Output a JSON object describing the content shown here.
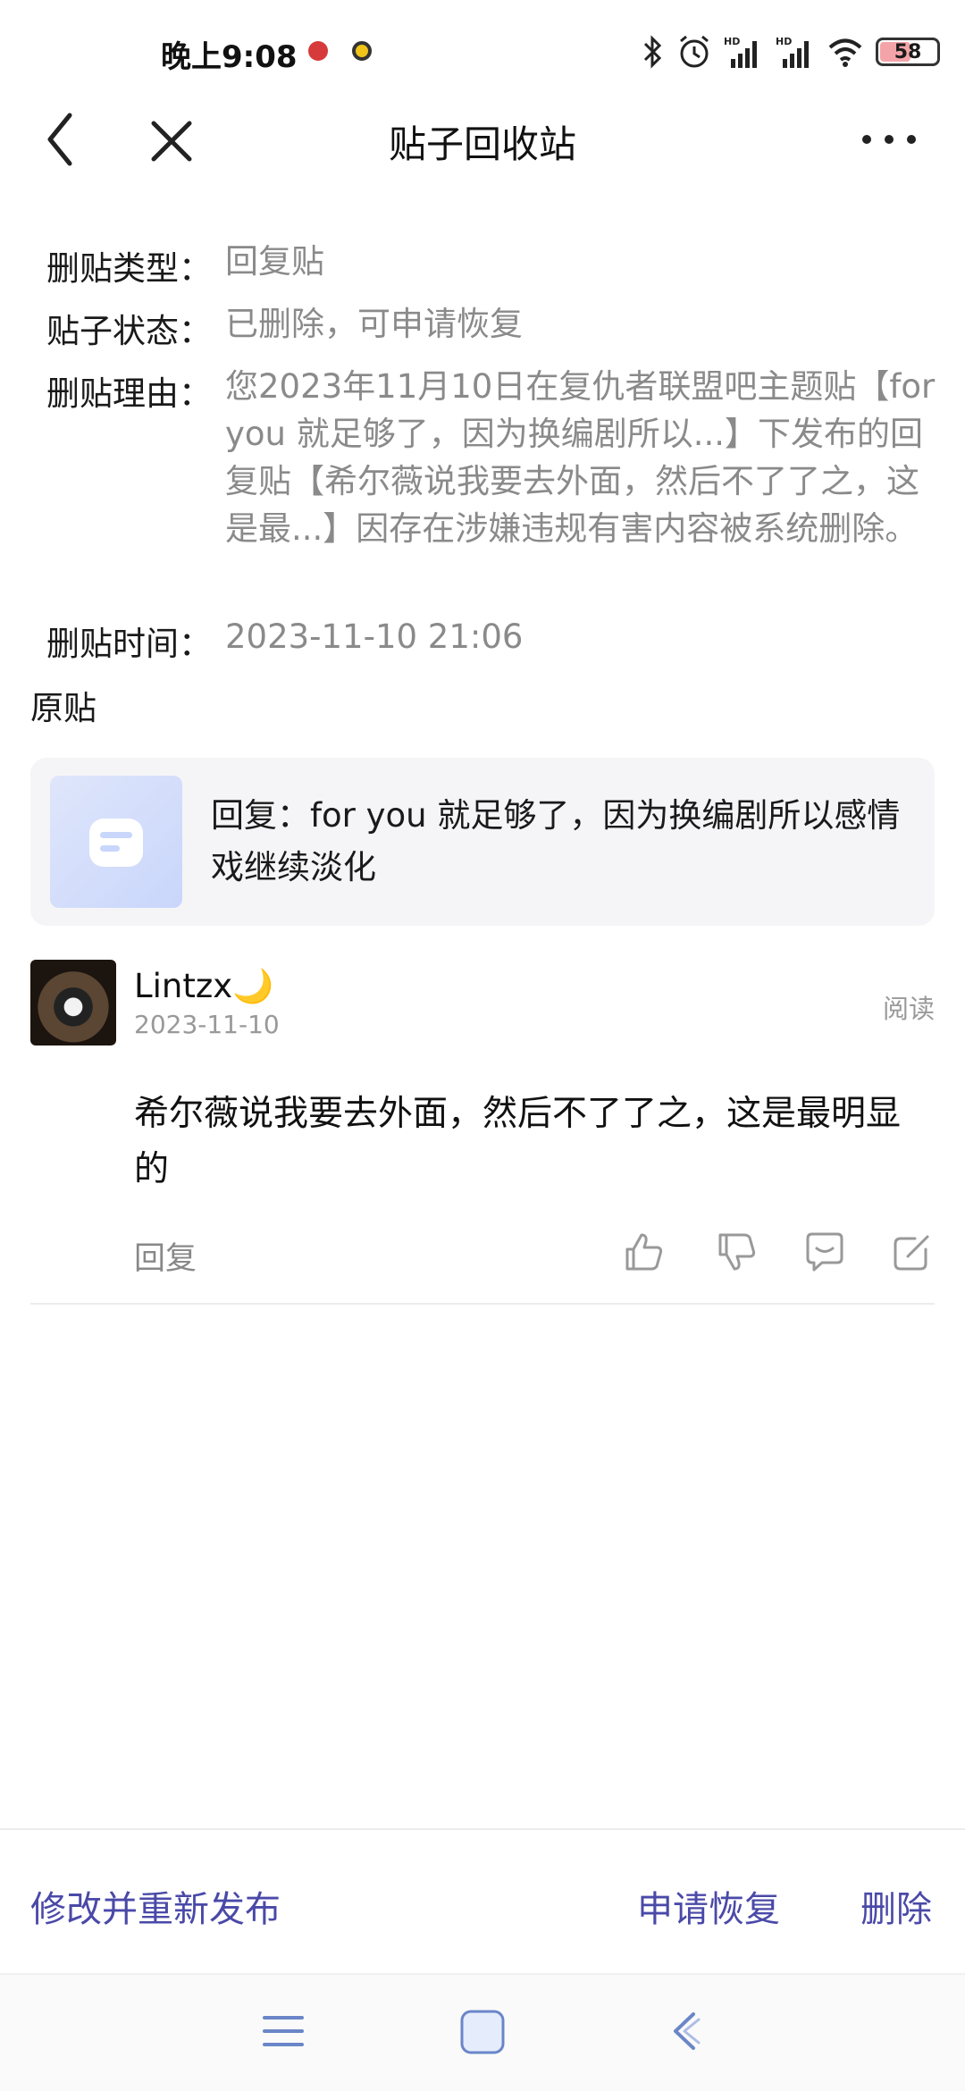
{
  "status_bar": {
    "time": "晚上9:08",
    "battery": "58",
    "battery_level": 0.58,
    "icons": [
      "notification-dot-red",
      "notification-dot-yellow",
      "bluetooth-icon",
      "alarm-icon",
      "signal-hd-icon",
      "signal-hd-icon",
      "wifi-icon",
      "battery-icon"
    ]
  },
  "header": {
    "title": "贴子回收站",
    "icons": [
      "back-icon",
      "close-icon",
      "more-icon"
    ]
  },
  "info": {
    "type_label": "删贴类型：",
    "type_value": "回复贴",
    "status_label": "贴子状态：",
    "status_value": "已删除，可申请恢复",
    "reason_label": "删贴理由：",
    "reason_value": "您2023年11月10日在复仇者联盟吧主题贴【for you 就足够了，因为换编剧所以...】下发布的回复贴【希尔薇说我要去外面，然后不了了之，这是最...】因存在涉嫌违规有害内容被系统删除。",
    "time_label": "删贴时间：",
    "time_value": "2023-11-10 21:06"
  },
  "original": {
    "section_title": "原贴",
    "card_text": "回复：for you 就足够了，因为换编剧所以感情戏继续淡化"
  },
  "reply": {
    "username": "Lintzx🌙",
    "date": "2023-11-10",
    "read_label": "阅读",
    "body": " 希尔薇说我要去外面，然后不了了之，这是最明显的",
    "reply_label": "回复",
    "icons": [
      "thumbs-up-icon",
      "thumbs-down-icon",
      "comment-icon",
      "edit-icon"
    ]
  },
  "bottom_actions": {
    "edit_republish": "修改并重新发布",
    "request_restore": "申请恢复",
    "delete": "删除"
  },
  "nav_bar": {
    "icons": [
      "menu-icon",
      "home-icon",
      "back-nav-icon"
    ]
  },
  "colors": {
    "accent": "#4a49a8",
    "muted_text": "#8a8a8a",
    "card_background": "#f5f5f7"
  }
}
